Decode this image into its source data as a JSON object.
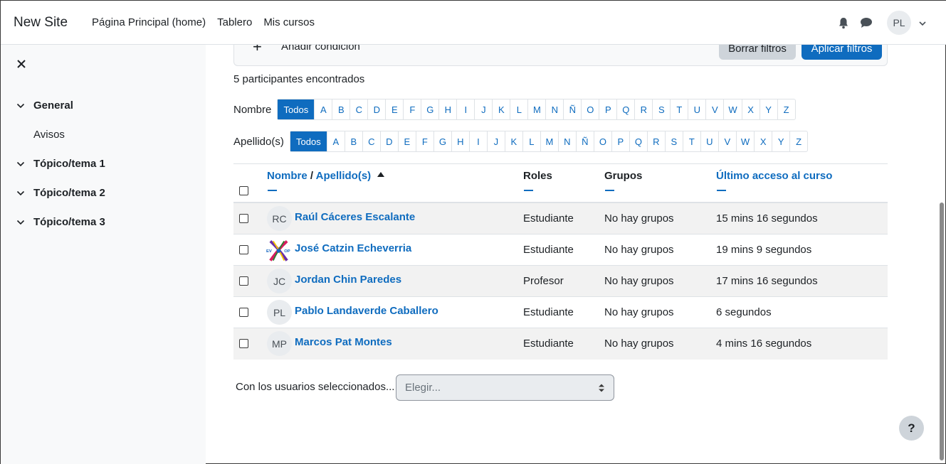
{
  "navbar": {
    "brand": "New Site",
    "links": [
      "Página Principal (home)",
      "Tablero",
      "Mis cursos"
    ],
    "user_initials": "PL"
  },
  "drawer": {
    "items": [
      {
        "label": "General",
        "sub": [
          "Avisos"
        ]
      },
      {
        "label": "Tópico/tema 1"
      },
      {
        "label": "Tópico/tema 2"
      },
      {
        "label": "Tópico/tema 3"
      }
    ]
  },
  "filters": {
    "add_condition": "Añadir condición",
    "clear_label": "Borrar filtros",
    "apply_label": "Aplicar filtros"
  },
  "found_text": "5 participantes encontrados",
  "initials": {
    "first_label": "Nombre",
    "last_label": "Apellido(s)",
    "all_label": "Todos",
    "letters": [
      "A",
      "B",
      "C",
      "D",
      "E",
      "F",
      "G",
      "H",
      "I",
      "J",
      "K",
      "L",
      "M",
      "N",
      "Ñ",
      "O",
      "P",
      "Q",
      "R",
      "S",
      "T",
      "U",
      "V",
      "W",
      "X",
      "Y",
      "Z"
    ]
  },
  "table": {
    "headers": {
      "name": "Nombre",
      "separator": "/",
      "lastname": "Apellido(s)",
      "roles": "Roles",
      "groups": "Grupos",
      "last_access": "Último acceso al curso"
    },
    "rows": [
      {
        "initials": "RC",
        "name": "Raúl Cáceres Escalante",
        "role": "Estudiante",
        "groups": "No hay grupos",
        "access": "15 mins 16 segundos"
      },
      {
        "initials": "",
        "logo_text": "EV  OP",
        "name": "José Catzin Echeverria",
        "role": "Estudiante",
        "groups": "No hay grupos",
        "access": "19 mins 9 segundos"
      },
      {
        "initials": "JC",
        "name": "Jordan Chin Paredes",
        "role": "Profesor",
        "groups": "No hay grupos",
        "access": "17 mins 16 segundos"
      },
      {
        "initials": "PL",
        "name": "Pablo Landaverde Caballero",
        "role": "Estudiante",
        "groups": "No hay grupos",
        "access": "6 segundos"
      },
      {
        "initials": "MP",
        "name": "Marcos Pat Montes",
        "role": "Estudiante",
        "groups": "No hay grupos",
        "access": "4 mins 16 segundos"
      }
    ]
  },
  "bulk": {
    "label": "Con los usuarios seleccionados...",
    "placeholder": "Elegir..."
  },
  "help_label": "?",
  "colors": {
    "primary": "#0f6cbf",
    "drawer_bg": "#f8f9fa"
  }
}
